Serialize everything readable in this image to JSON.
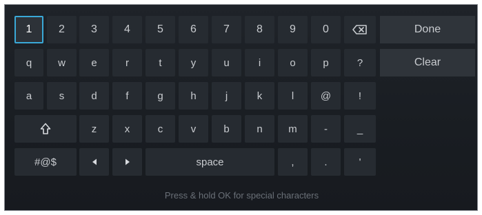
{
  "keyboard": {
    "row1": [
      "1",
      "2",
      "3",
      "4",
      "5",
      "6",
      "7",
      "8",
      "9",
      "0"
    ],
    "row2": [
      "q",
      "w",
      "e",
      "r",
      "t",
      "y",
      "u",
      "i",
      "o",
      "p",
      "?"
    ],
    "row3": [
      "a",
      "s",
      "d",
      "f",
      "g",
      "h",
      "j",
      "k",
      "l",
      "@",
      "!"
    ],
    "row4": [
      "z",
      "x",
      "c",
      "v",
      "b",
      "n",
      "m",
      "-",
      "_"
    ],
    "row5": {
      "symbols": "#@$",
      "space": "space",
      "comma": ",",
      "period": ".",
      "apostrophe": "'"
    }
  },
  "actions": {
    "done": "Done",
    "clear": "Clear"
  },
  "hint": "Press & hold OK for special characters",
  "colors": {
    "focus": "#3aa9d8",
    "key": "#262b31",
    "panel": "#1b1f24"
  },
  "icons": [
    "backspace-icon",
    "shift-icon",
    "arrow-left-icon",
    "arrow-right-icon"
  ]
}
